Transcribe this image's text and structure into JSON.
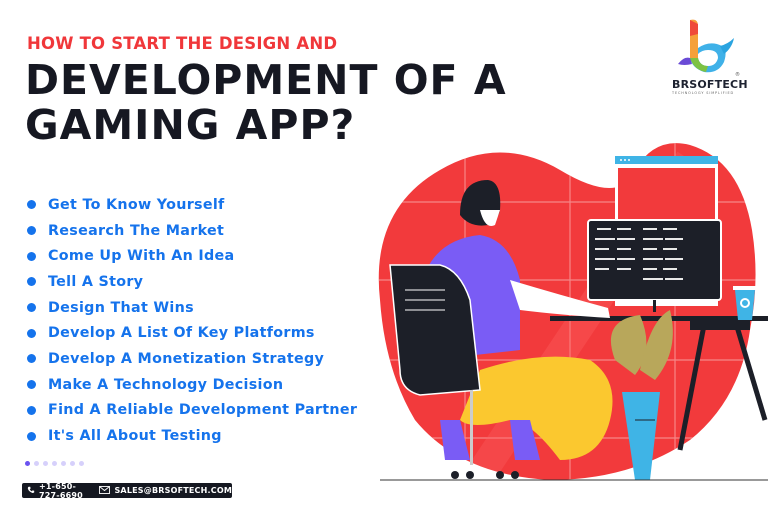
{
  "header": {
    "subtitle": "HOW TO START THE DESIGN AND",
    "title_line1": "DEVELOPMENT OF A",
    "title_line2": "GAMING APP?"
  },
  "steps": [
    {
      "label": "Get To Know Yourself"
    },
    {
      "label": "Research The Market"
    },
    {
      "label": "Come Up With An Idea"
    },
    {
      "label": "Tell A Story"
    },
    {
      "label": "Design That Wins"
    },
    {
      "label": "Develop A List Of Key Platforms"
    },
    {
      "label": "Develop A Monetization Strategy"
    },
    {
      "label": "Make A Technology Decision"
    },
    {
      "label": "Find A Reliable Development Partner"
    },
    {
      "label": "It's All About Testing"
    }
  ],
  "pagination": {
    "total": 7,
    "active": 1
  },
  "contact": {
    "phone_icon": "phone-icon",
    "phone": "+1-650-727-6690",
    "email_icon": "envelope-icon",
    "email": "SALES@BRSOFTECH.COM"
  },
  "logo": {
    "name": "BRSOFTECH",
    "tagline": "TECHNOLOGY SIMPLIFIED",
    "registered": "®"
  },
  "illustration": {
    "subject": "developer-at-computer",
    "colors": {
      "blob": "#f23a3c",
      "shirt": "#7a5cf5",
      "pants": "#fbc82f",
      "screen": "#1c1f28",
      "cup": "#3fb4e6",
      "plant": "#b8a75b"
    }
  },
  "colors": {
    "accent_red": "#f0373a",
    "accent_blue": "#1573ec",
    "title_dark": "#161822"
  }
}
